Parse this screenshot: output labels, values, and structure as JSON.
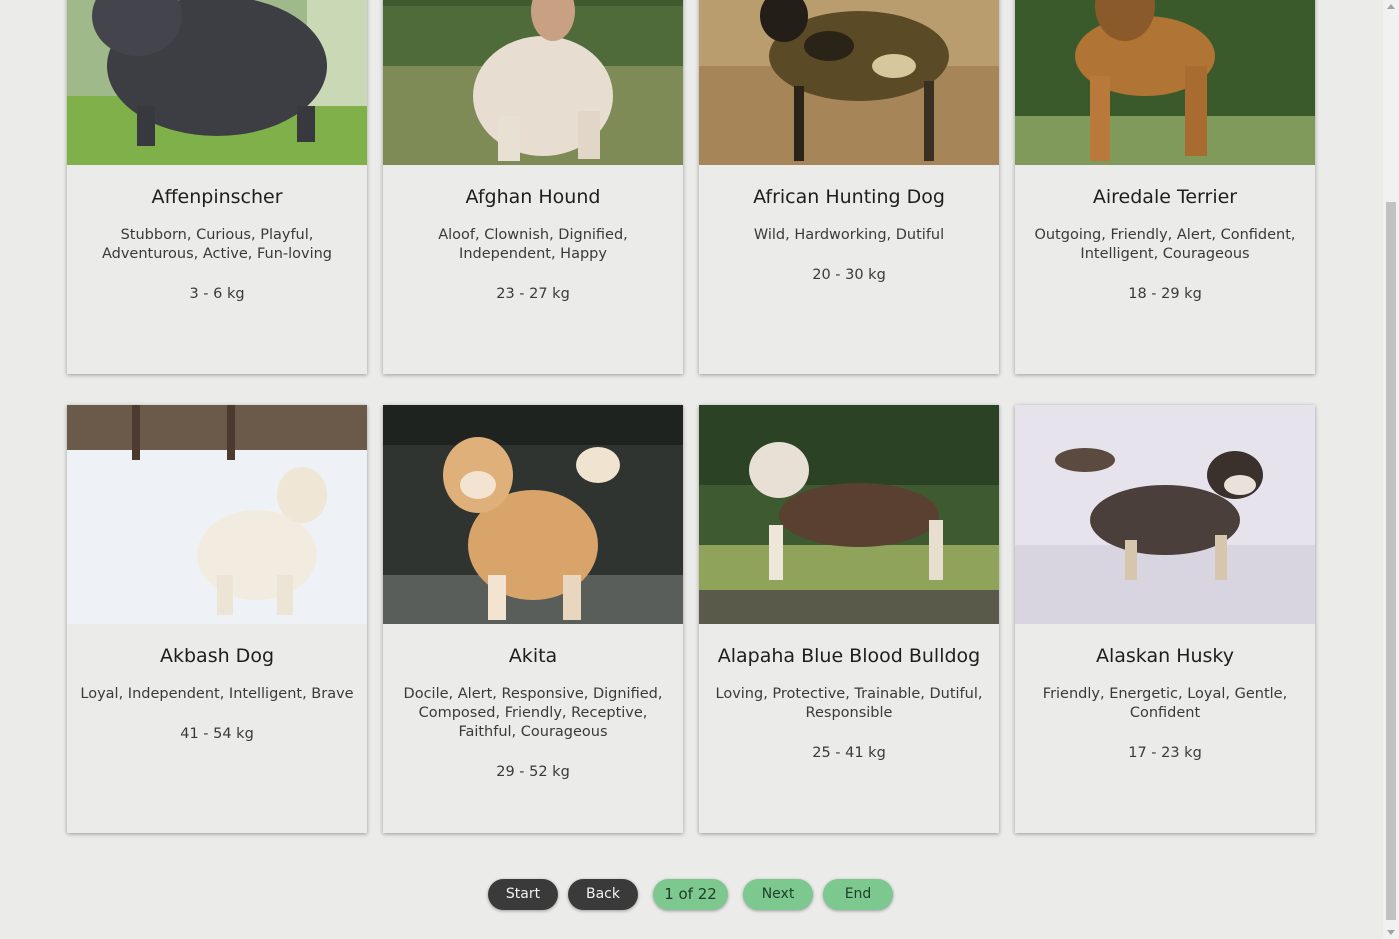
{
  "breeds": [
    {
      "name": "Affenpinscher",
      "temperament": "Stubborn, Curious, Playful, Adventurous, Active, Fun-loving",
      "weight": "3 - 6 kg"
    },
    {
      "name": "Afghan Hound",
      "temperament": "Aloof, Clownish, Dignified, Independent, Happy",
      "weight": "23 - 27 kg"
    },
    {
      "name": "African Hunting Dog",
      "temperament": "Wild, Hardworking, Dutiful",
      "weight": "20 - 30 kg"
    },
    {
      "name": "Airedale Terrier",
      "temperament": "Outgoing, Friendly, Alert, Confident, Intelligent, Courageous",
      "weight": "18 - 29 kg"
    },
    {
      "name": "Akbash Dog",
      "temperament": "Loyal, Independent, Intelligent, Brave",
      "weight": "41 - 54 kg"
    },
    {
      "name": "Akita",
      "temperament": "Docile, Alert, Responsive, Dignified, Composed, Friendly, Receptive, Faithful, Courageous",
      "weight": "29 - 52 kg"
    },
    {
      "name": "Alapaha Blue Blood Bulldog",
      "temperament": "Loving, Protective, Trainable, Dutiful, Responsible",
      "weight": "25 - 41 kg"
    },
    {
      "name": "Alaskan Husky",
      "temperament": "Friendly, Energetic, Loyal, Gentle, Confident",
      "weight": "17 - 23 kg"
    }
  ],
  "pagination": {
    "start_label": "Start",
    "back_label": "Back",
    "page_indicator": "1 of 22",
    "next_label": "Next",
    "end_label": "End"
  },
  "colors": {
    "background": "#ebebe9",
    "dark_button": "#3a3a3a",
    "green_button": "#7cc88f"
  }
}
